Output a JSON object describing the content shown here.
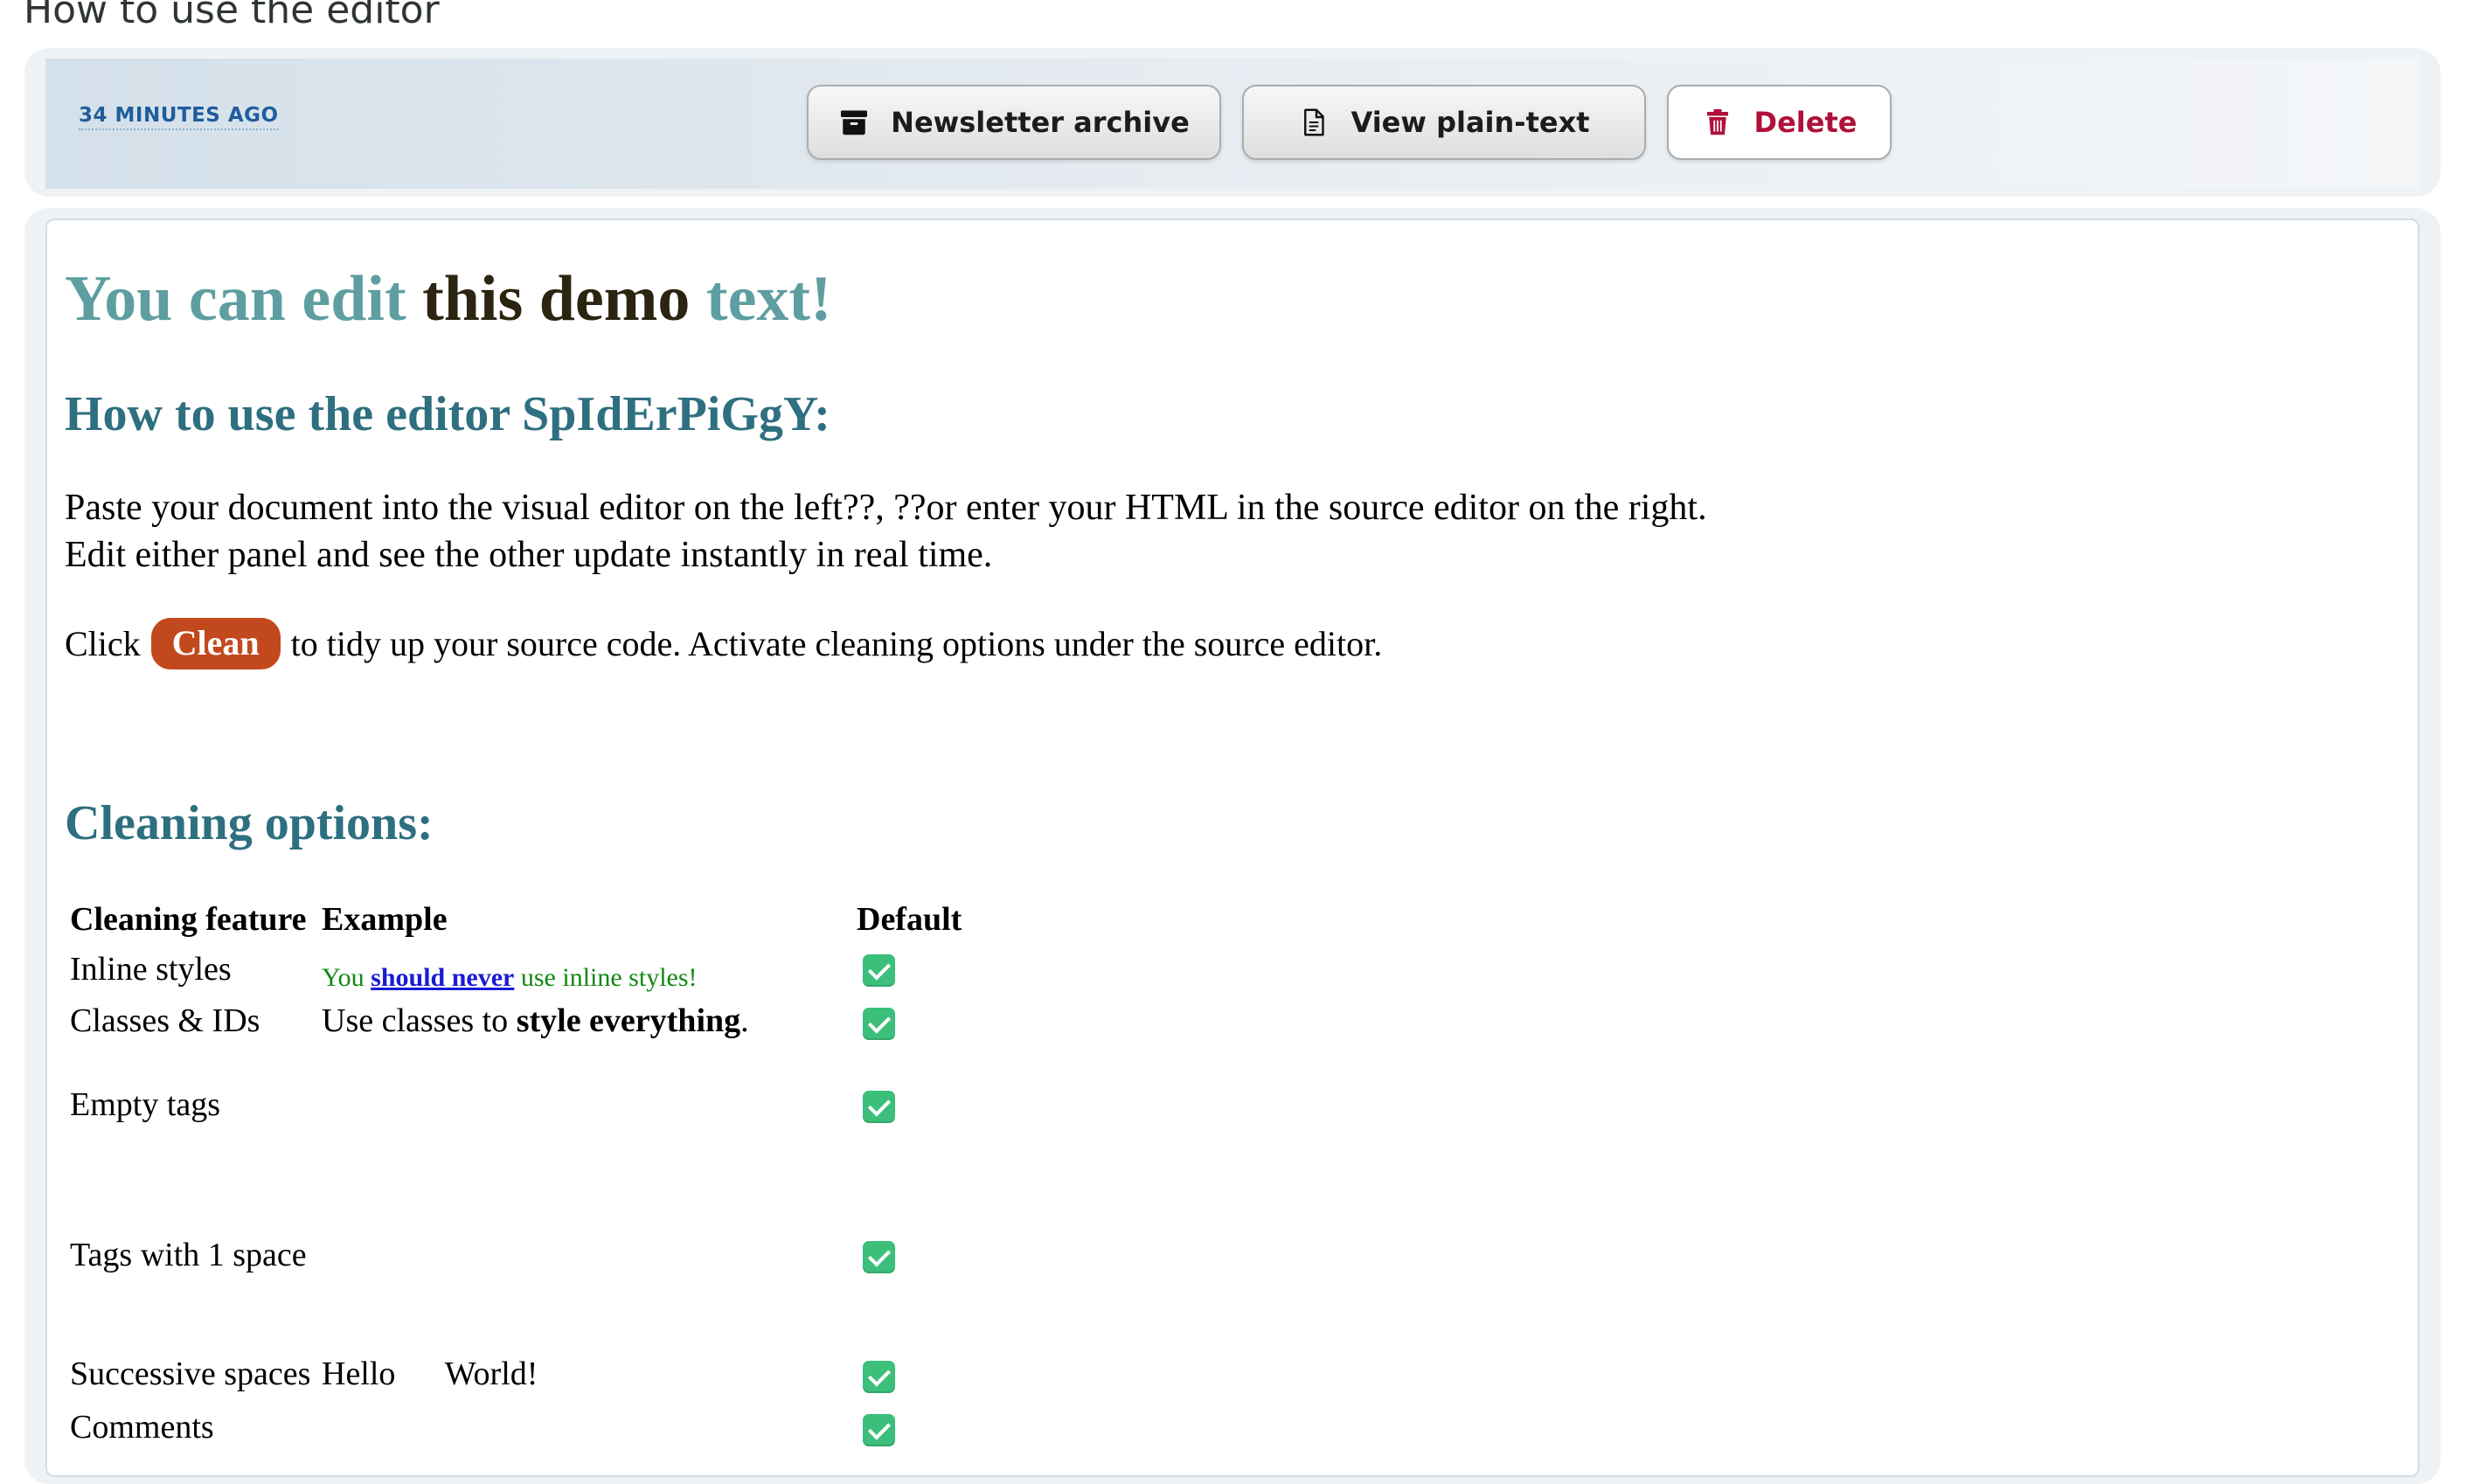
{
  "page": {
    "heading": "How to use the editor"
  },
  "toolbar": {
    "timestamp": "34 MINUTES AGO",
    "archive_label": "Newsletter archive",
    "plaintext_label": "View plain-text",
    "delete_label": "Delete",
    "archive_icon": "archive-box-icon",
    "plaintext_icon": "document-text-icon",
    "delete_icon": "trash-icon"
  },
  "content": {
    "title_part1": "You can edit ",
    "title_part2": "this demo",
    "title_part3": " text!",
    "subtitle": "How to use the editor SpIdErPiGgY:",
    "paragraph_line1": "Paste your document into the visual editor on the left??, ??or enter your HTML in the source editor on the right.",
    "paragraph_line2": "Edit either panel and see the other update instantly in real time.",
    "click_prefix": "Click",
    "clean_label": "Clean",
    "click_suffix": "to tidy up your source code. Activate cleaning options under the source editor.",
    "options_heading": "Cleaning options:"
  },
  "table": {
    "headers": [
      "Cleaning feature",
      "Example",
      "Default"
    ],
    "rows": [
      {
        "feature": "Inline styles",
        "example_pre": "You ",
        "example_link": "should never",
        "example_post": " use inline styles!",
        "default": "checked"
      },
      {
        "feature": "Classes & IDs",
        "example_pre": "Use classes to ",
        "example_bold": "style everything",
        "example_post": ".",
        "default": "checked"
      },
      {
        "feature": "Empty tags",
        "default": "checked"
      },
      {
        "feature": "Tags with 1 space",
        "default": "checked"
      },
      {
        "feature": "Successive spaces",
        "example": "Hello      World!",
        "default": "checked"
      },
      {
        "feature": "Comments",
        "default": "checked"
      }
    ]
  },
  "colors": {
    "title_teal": "#5f9ea0",
    "heading_teal": "#2e6f80",
    "clean_button": "#c2491d",
    "delete_red": "#b0103a",
    "timestamp_blue": "#1f5d9c",
    "check_green": "#3cbf7a"
  }
}
